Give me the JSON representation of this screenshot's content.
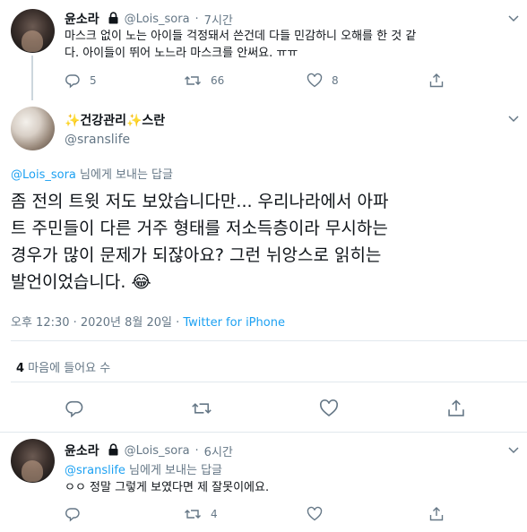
{
  "tweet1": {
    "display_name": "윤소라",
    "handle": "@Lois_sora",
    "separator": "·",
    "time": "7시간",
    "text_line1": "마스크 없이 노는 아이들 걱정돼서 쓴건데 다들 민감하니 오해를 한 것 같",
    "text_line2": "다. 아이들이 뛰어 노느라 마스크를 안써요. ㅠㅠ",
    "reply_count": "5",
    "retweet_count": "66",
    "like_count": "8"
  },
  "main_tweet": {
    "display_name": "✨건강관리✨스란",
    "handle": "@sranslife",
    "reply_to_handle": "@Lois_sora",
    "reply_to_suffix": " 님에게 보내는 답글",
    "text_line1": "좀 전의 트윗 저도 보았습니다만... 우리나라에서 아파",
    "text_line2": "트 주민들이 다른 거주 형태를 저소득층이라 무시하는",
    "text_line3": "경우가 많이 문제가 되잖아요? 그런 뉘앙스로 읽히는",
    "text_line4": "발언이었습니다.",
    "emoji": "😂",
    "timestamp": "오후 12:30 · 2020년 8월 20일 · ",
    "source": "Twitter for iPhone",
    "likes_number": "4",
    "likes_label": " 마음에 들어요 수"
  },
  "tweet3": {
    "display_name": "윤소라",
    "handle": "@Lois_sora",
    "separator": "·",
    "time": "6시간",
    "reply_to_handle": "@sranslife",
    "reply_to_suffix": " 님에게 보내는 답글",
    "text": "ㅇㅇ 정말 그렇게 보였다면 제 잘못이에요.",
    "retweet_count": "4"
  },
  "colors": {
    "accent": "#1da1f2",
    "muted": "#657786",
    "divider": "#e1e8ed"
  }
}
